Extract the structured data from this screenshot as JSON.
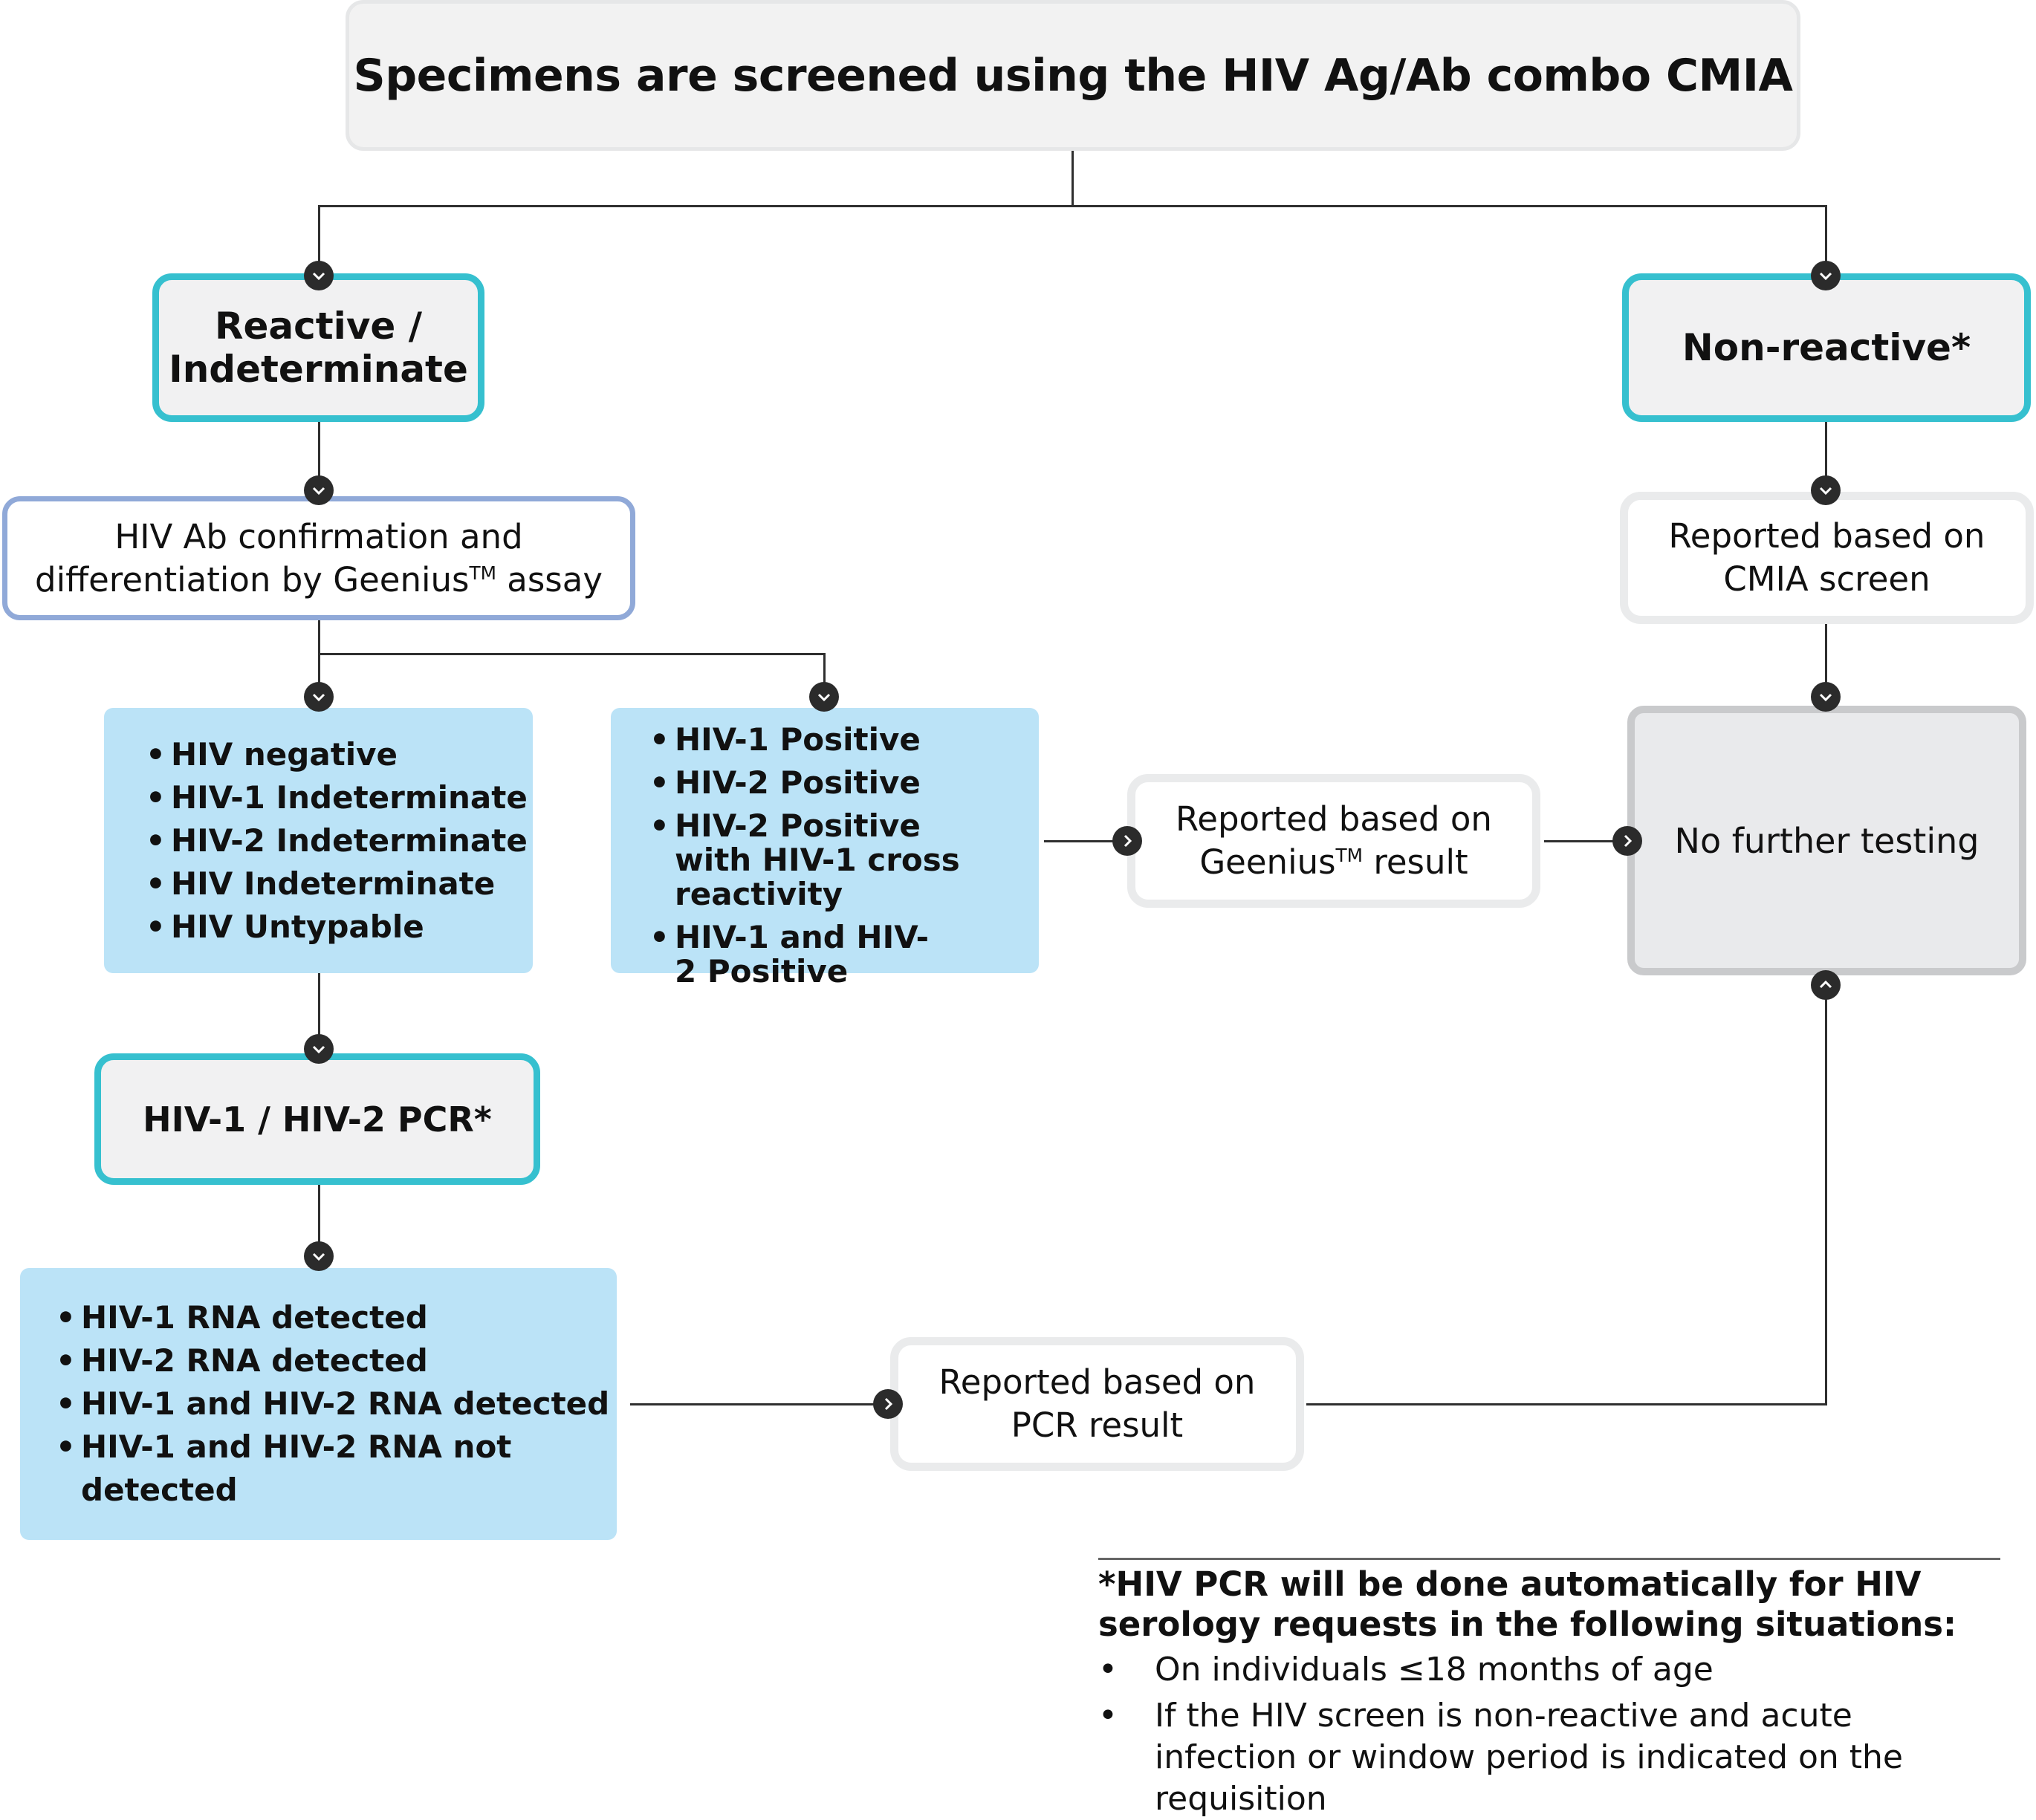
{
  "title": "Specimens are screened using the HIV Ag/Ab combo CMIA",
  "colors": {
    "teal_border": "#36c0cf",
    "purple_border": "#90a9d8",
    "result_fill": "#bbe3f7",
    "neutral_fill": "#f1f1f2",
    "final_fill": "#e9eaec",
    "connector": "#2f2f2f"
  },
  "nodes": {
    "reactive": {
      "line1": "Reactive /",
      "line2": "Indeterminate"
    },
    "non_reactive": {
      "label": "Non-reactive*"
    },
    "geenius_assay": {
      "line1": "HIV Ab confirmation and",
      "line2_pre": "differentiation by Geenius",
      "tm": "TM",
      "line2_post": " assay"
    },
    "negative_results": {
      "items": [
        "HIV negative",
        "HIV-1 Indeterminate",
        "HIV-2 Indeterminate",
        "HIV Indeterminate",
        "HIV Untypable"
      ]
    },
    "positive_results": {
      "items": [
        "HIV-1 Positive",
        "HIV-2 Positive",
        "HIV-2 Positive with HIV-1 cross reactivity",
        "HIV-1 and HIV-2 Positive"
      ]
    },
    "reported_geenius": {
      "line1": "Reported based on",
      "line2_pre": "Geenius",
      "tm": "TM",
      "line2_post": " result"
    },
    "reported_cmia": {
      "line1": "Reported based on",
      "line2": "CMIA screen"
    },
    "no_further_testing": {
      "label": "No further testing"
    },
    "pcr": {
      "label": "HIV-1 / HIV-2 PCR*"
    },
    "pcr_results": {
      "items": [
        "HIV-1 RNA detected",
        "HIV-2 RNA detected",
        "HIV-1 and HIV-2 RNA detected",
        "HIV-1 and HIV-2 RNA not detected"
      ]
    },
    "reported_pcr": {
      "line1": "Reported based on",
      "line2": "PCR result"
    }
  },
  "connector_icons": {
    "down": "chevron-down-icon",
    "right": "chevron-right-icon",
    "up": "chevron-up-icon"
  },
  "footnote": {
    "title": "*HIV PCR will be done automatically for HIV serology requests in the following situations:",
    "items": [
      "On individuals ≤18 months of age",
      "If the HIV screen is non-reactive and acute infection or window period is indicated on the requisition"
    ]
  }
}
